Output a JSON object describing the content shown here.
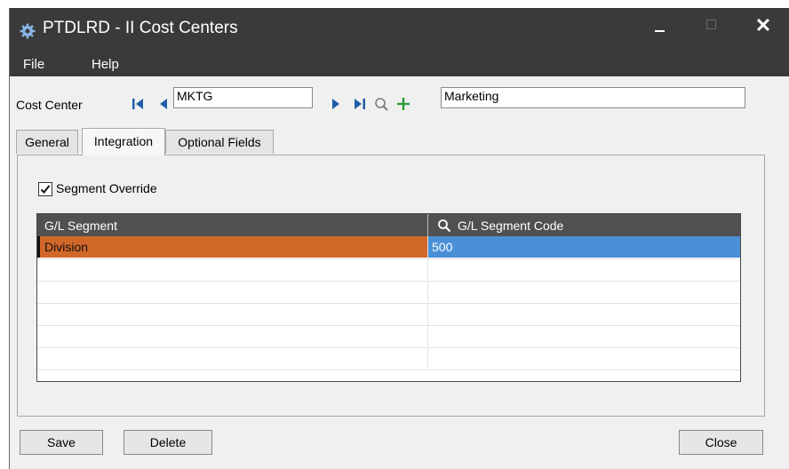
{
  "window": {
    "title": "PTDLRD - II Cost Centers",
    "app_icon": "gear-icon",
    "controls": {
      "minimize": "minimize-icon",
      "maximize": "maximize-icon",
      "close": "✕"
    }
  },
  "menu": {
    "file": "File",
    "help": "Help"
  },
  "header": {
    "cost_center_label": "Cost Center",
    "cost_center_code": "MKTG",
    "cost_center_description": "Marketing",
    "icons": [
      "first-record-icon",
      "previous-record-icon",
      "next-record-icon",
      "last-record-icon",
      "search-icon",
      "add-icon"
    ]
  },
  "tabs": {
    "general": "General",
    "integration": "Integration",
    "optional_fields": "Optional Fields",
    "active": "Integration"
  },
  "integration": {
    "segment_override_label": "Segment Override",
    "segment_override_checked": true
  },
  "grid": {
    "columns": {
      "segment": "G/L Segment",
      "segment_code": "G/L Segment Code"
    },
    "rows": [
      {
        "segment": "Division",
        "segment_code": "500"
      }
    ]
  },
  "buttons": {
    "save": "Save",
    "delete": "Delete",
    "close": "Close"
  },
  "colors": {
    "titlebar": "#3a3a3a",
    "selected_row": "#d2672a",
    "selected_cell": "#4a90d6",
    "add_icon": "#2a9a3a",
    "nav_icons": "#1f5fa8"
  }
}
